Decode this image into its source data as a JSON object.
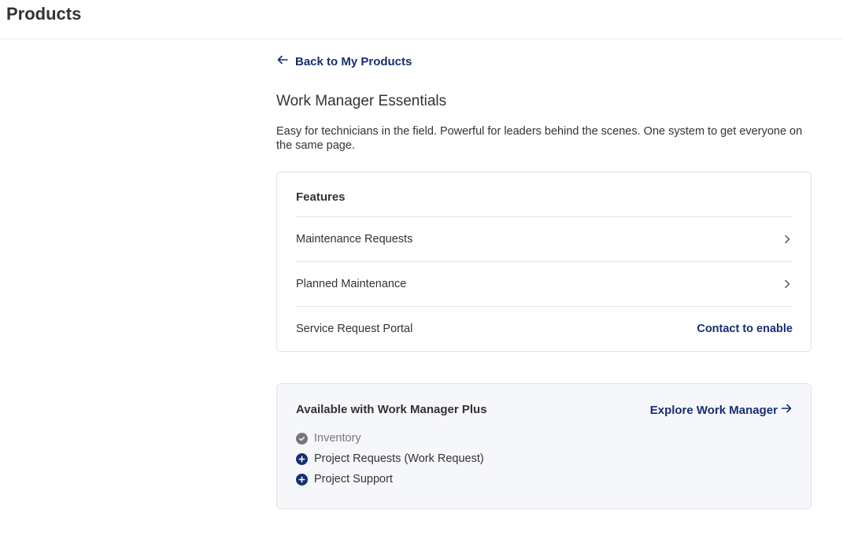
{
  "header": {
    "title": "Products"
  },
  "back_link": {
    "label": "Back to My Products"
  },
  "product": {
    "title": "Work Manager Essentials",
    "description": "Easy for technicians in the field. Powerful for leaders behind the scenes. One system to get everyone on the same page."
  },
  "features": {
    "heading": "Features",
    "items": [
      {
        "label": "Maintenance Requests",
        "action": "chevron-right-icon"
      },
      {
        "label": "Planned Maintenance",
        "action": "chevron-right-icon"
      },
      {
        "label": "Service Request Portal",
        "action_label": "Contact to enable"
      }
    ]
  },
  "upgrade": {
    "heading": "Available with Work Manager Plus",
    "explore_label": "Explore Work Manager",
    "items": [
      {
        "label": "Inventory",
        "status": "included",
        "icon": "check-circle-icon"
      },
      {
        "label": "Project Requests (Work Request)",
        "status": "add",
        "icon": "plus-circle-icon"
      },
      {
        "label": "Project Support",
        "status": "add",
        "icon": "plus-circle-icon"
      }
    ]
  },
  "colors": {
    "link": "#162f6f",
    "included_icon": "#777777",
    "add_icon": "#162f6f",
    "upgrade_bg": "#f6f7fb"
  }
}
